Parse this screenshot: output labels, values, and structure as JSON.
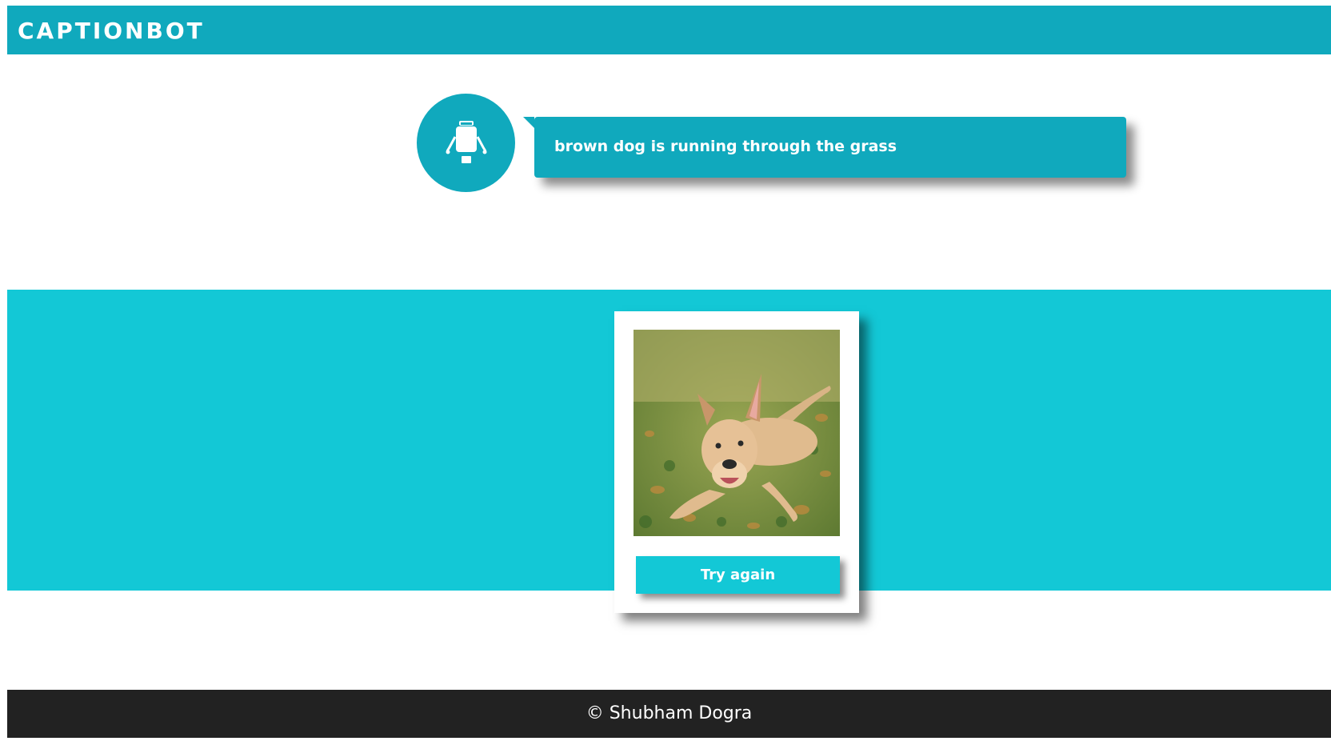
{
  "navbar": {
    "brand": "CAPTIONBOT"
  },
  "bot": {
    "icon": "robot-icon",
    "caption": "brown dog is running through the grass"
  },
  "upload": {
    "image": "dog-photo",
    "try_again_label": "Try again"
  },
  "footer": {
    "copyright": "© Shubham Dogra"
  },
  "colors": {
    "accent": "#10a9bd",
    "band": "#13c8d6",
    "footer": "#222222",
    "text": "#ffffff"
  }
}
